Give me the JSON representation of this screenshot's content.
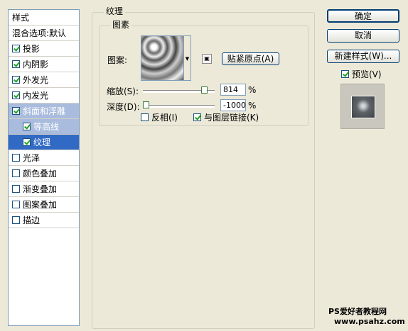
{
  "left_panel": {
    "header": "样式",
    "blend_options": "混合选项:默认",
    "items": [
      {
        "label": "投影",
        "checked": true
      },
      {
        "label": "内阴影",
        "checked": true
      },
      {
        "label": "外发光",
        "checked": true
      },
      {
        "label": "内发光",
        "checked": true
      },
      {
        "label": "斜面和浮雕",
        "checked": true
      },
      {
        "label": "等高线",
        "checked": true
      },
      {
        "label": "纹理",
        "checked": true
      },
      {
        "label": "光泽",
        "checked": false
      },
      {
        "label": "颜色叠加",
        "checked": false
      },
      {
        "label": "渐变叠加",
        "checked": false
      },
      {
        "label": "图案叠加",
        "checked": false
      },
      {
        "label": "描边",
        "checked": false
      }
    ]
  },
  "texture_panel": {
    "title": "纹理",
    "pattern_group_title": "图素",
    "pattern_label": "图案:",
    "snap_origin_button": "贴紧原点(A)",
    "scale_label": "缩放(S):",
    "scale_value": "814",
    "scale_unit": "%",
    "scale_level_percent": 81.4,
    "depth_label": "深度(D):",
    "depth_value": "-1000",
    "depth_unit": "%",
    "depth_level_fraction": 0.0,
    "invert_label": "反相(I)",
    "invert_checked": false,
    "link_label": "与图层链接(K)",
    "link_checked": true
  },
  "right_panel": {
    "ok_button": "确定",
    "cancel_button": "取消",
    "new_style_button": "新建样式(W)...",
    "preview_label": "预览(V)",
    "preview_checked": true
  },
  "watermark": {
    "line1": "PS爱好者教程网",
    "line2": "www.psahz.com"
  },
  "icons": {
    "pattern_dropdown": "chevron-down-icon",
    "new_preset": "new-preset-icon",
    "checkbox_checked": "checkmark-icon"
  },
  "colors": {
    "selection_active": "#316AC5",
    "selection_parent": "#A9BCDE",
    "checkmark": "#21A121",
    "dialog_bg": "#ECE9D8"
  }
}
